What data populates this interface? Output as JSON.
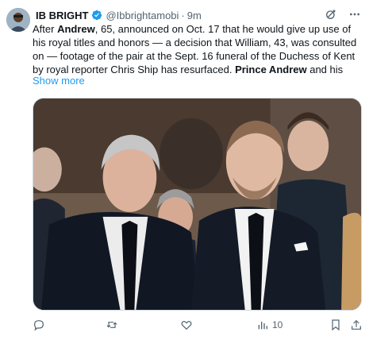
{
  "tweet": {
    "author": {
      "display_name": "IB BRIGHT",
      "handle": "@Ibbrightamobi",
      "separator": "·",
      "time": "9m",
      "avatar_icon": "user-avatar",
      "verified_icon": "verified-badge-icon",
      "verified_color": "#1d9bf0"
    },
    "text": {
      "p1": "After ",
      "b1": "Andrew",
      "p2": ", 65, announced on Oct. 17 that he would give up use of his royal titles and honors — a decision that William, 43, was consulted on — footage of the pair at the Sept. 16 funeral of the Duchess of Kent by royal reporter Chris Ship has resurfaced. ",
      "b2": "Prince Andrew",
      "p3": " and his"
    },
    "show_more": "Show more",
    "header_icons": [
      "grok-icon",
      "more-icon"
    ],
    "actions": {
      "reply_icon": "reply-icon",
      "retweet_icon": "retweet-icon",
      "like_icon": "like-icon",
      "views_icon": "views-icon",
      "views_count": "10",
      "bookmark_icon": "bookmark-icon",
      "share_icon": "share-icon"
    },
    "colors": {
      "text": "#0f1419",
      "muted": "#536471",
      "link": "#1d9bf0"
    }
  }
}
